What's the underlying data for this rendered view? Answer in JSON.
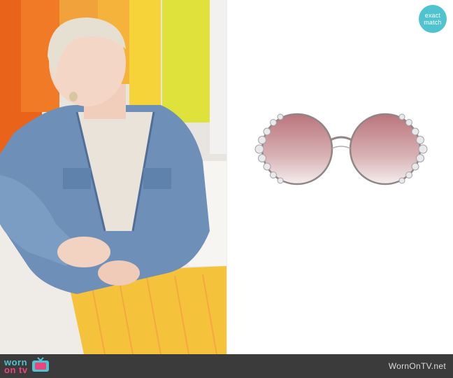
{
  "badge": {
    "line1": "exact",
    "line2": "match"
  },
  "footer": {
    "logo_top": "worn",
    "logo_bottom": "on tv",
    "site_url": "WornOnTV.net"
  },
  "colors": {
    "badge": "#4fc3cf",
    "footer_bg": "#3b3b3b",
    "logo_worn": "#4fc3cf",
    "logo_ontv": "#e8477d"
  },
  "icons": [
    "tv-icon"
  ]
}
